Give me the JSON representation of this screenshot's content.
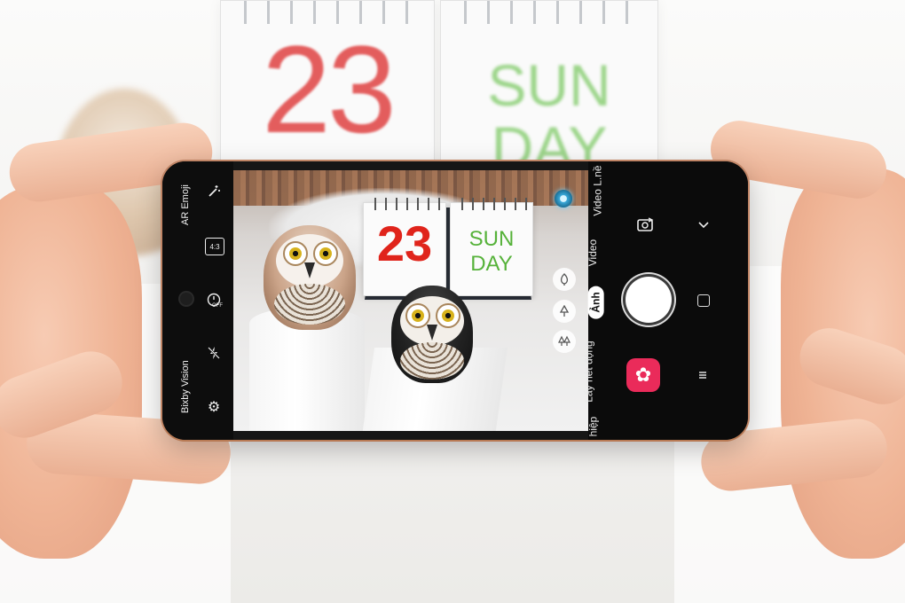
{
  "background": {
    "calendar_number": "23",
    "calendar_word_top": "SUN",
    "calendar_word_bottom": "DAY"
  },
  "camera": {
    "left_toolbar": {
      "ar_emoji_label": "AR Emoji",
      "bixby_vision_label": "Bixby Vision",
      "ratio_label": "4:3",
      "timer_label": "OFF",
      "icons": [
        "magic-wand-icon",
        "aspect-ratio-icon",
        "timer-icon",
        "flash-off-icon",
        "settings-icon",
        "front-camera-lens"
      ]
    },
    "viewfinder": {
      "calendar_number": "23",
      "calendar_word_top": "SUN",
      "calendar_word_bottom": "DAY",
      "scene_selector_icons": [
        "leaf-icon",
        "tree-icon",
        "trees-icon"
      ],
      "scene_optimizer_indicator": "scene-optimizer-dot"
    },
    "modes": {
      "video_l": "Video L.nề",
      "video": "Video",
      "photo": "Ảnh",
      "live_focus": "Lấy nét động",
      "combo": "hiệp"
    },
    "controls": {
      "switch_camera_icon": "switch-camera-icon",
      "expand_icon": "chevron-down-icon",
      "shutter": "shutter-button",
      "gallery_icon": "flower-icon",
      "nav_home": "home-icon",
      "nav_recent": "recent-apps-icon"
    },
    "colors": {
      "gallery_accent": "#ea2b5a",
      "calendar_red": "#e0241b",
      "calendar_green": "#56b23a"
    }
  }
}
